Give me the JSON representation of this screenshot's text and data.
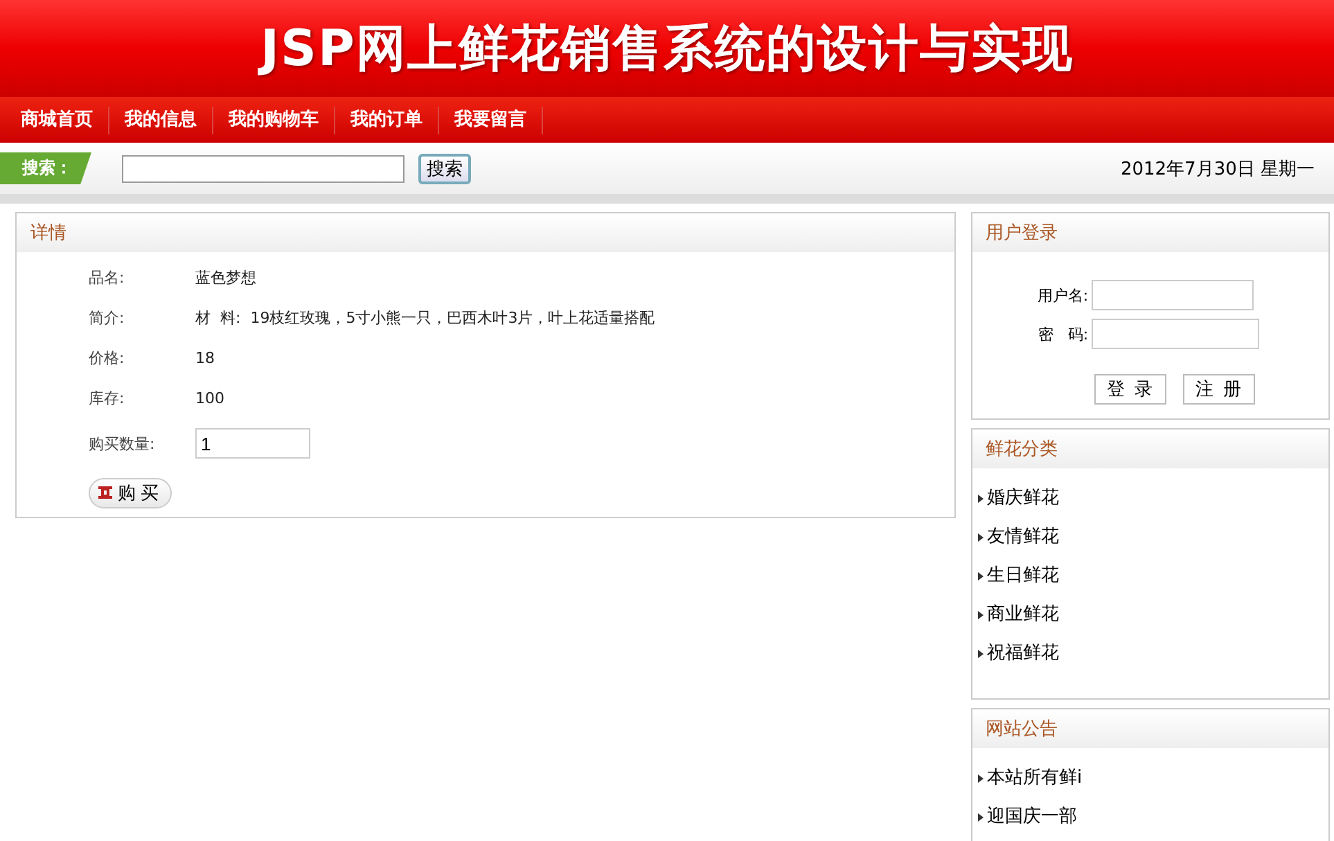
{
  "banner": {
    "title": "JSP网上鲜花销售系统的设计与实现"
  },
  "nav": [
    {
      "label": "商城首页"
    },
    {
      "label": "我的信息"
    },
    {
      "label": "我的购物车"
    },
    {
      "label": "我的订单"
    },
    {
      "label": "我要留言"
    }
  ],
  "search": {
    "label": "搜索：",
    "button": "搜索",
    "date": "2012年7月30日 星期一"
  },
  "detail": {
    "title": "详情",
    "fields": [
      {
        "label": "品名:",
        "value": "蓝色梦想"
      },
      {
        "label": "简介:",
        "value": "材  料:  19枝红玫瑰，5寸小熊一只，巴西木叶3片，叶上花适量搭配"
      },
      {
        "label": "价格:",
        "value": "18"
      },
      {
        "label": "库存:",
        "value": "100"
      }
    ],
    "quantity": {
      "label": "购买数量:",
      "value": "1"
    },
    "buy_button": "购 买"
  },
  "login": {
    "title": "用户登录",
    "username_label": "用户名:",
    "password_label": "密   码:",
    "buttons": [
      "登  录",
      "注  册"
    ]
  },
  "categories": {
    "title": "鲜花分类",
    "items": [
      "婚庆鲜花",
      "友情鲜花",
      "生日鲜花",
      "商业鲜花",
      "祝福鲜花"
    ]
  },
  "notices": {
    "title": "网站公告",
    "items": [
      "本站所有鲜i",
      "迎国庆一部"
    ]
  }
}
